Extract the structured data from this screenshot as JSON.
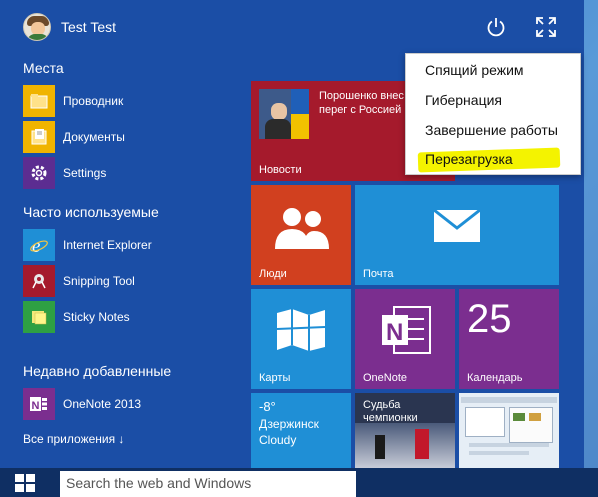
{
  "user": {
    "name": "Test Test"
  },
  "sections": {
    "places": "Места",
    "most_used": "Часто используемые",
    "recent": "Недавно добавленные"
  },
  "places_items": [
    {
      "label": "Проводник",
      "icon": "file-explorer-icon"
    },
    {
      "label": "Документы",
      "icon": "documents-icon"
    },
    {
      "label": "Settings",
      "icon": "gear-icon"
    }
  ],
  "most_used_items": [
    {
      "label": "Internet Explorer",
      "icon": "internet-explorer-icon"
    },
    {
      "label": "Snipping Tool",
      "icon": "snipping-tool-icon"
    },
    {
      "label": "Sticky Notes",
      "icon": "sticky-notes-icon"
    }
  ],
  "recent_items": [
    {
      "label": "OneNote 2013",
      "icon": "onenote-icon"
    }
  ],
  "all_apps": "Все приложения ↓",
  "tiles": {
    "news": {
      "label": "Новости",
      "headline": "Порошенко внес на новые перег с Россией"
    },
    "people": {
      "label": "Люди"
    },
    "mail": {
      "label": "Почта"
    },
    "maps": {
      "label": "Карты"
    },
    "onenote": {
      "label": "OneNote"
    },
    "calendar": {
      "label": "Календарь",
      "day": "25"
    },
    "weather": {
      "temp": "-8°",
      "city": "Дзержинск",
      "condition": "Cloudy"
    },
    "sport": {
      "headline": "Судьба чемпионки"
    }
  },
  "power_menu": [
    "Спящий режим",
    "Гибернация",
    "Завершение работы",
    "Перезагрузка"
  ],
  "taskbar": {
    "search_placeholder": "Search the web and Windows"
  },
  "colors": {
    "start_bg": "#1b4ea6",
    "news": "#a51a2c",
    "people": "#d1401f",
    "mail": "#1f8fd6",
    "maps": "#1f8fd6",
    "onenote": "#7b2e8f",
    "calendar": "#7b2e8f",
    "weather": "#1f8fd6",
    "highlight": "#f4f300"
  }
}
